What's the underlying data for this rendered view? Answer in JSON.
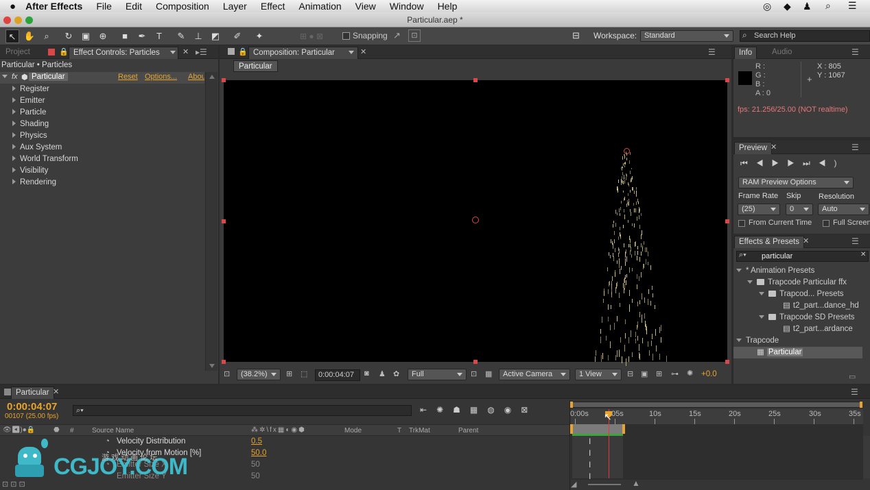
{
  "menubar": {
    "app": "After Effects",
    "items": [
      "File",
      "Edit",
      "Composition",
      "Layer",
      "Effect",
      "Animation",
      "View",
      "Window",
      "Help"
    ]
  },
  "window": {
    "title": "Particular.aep *"
  },
  "toolbar": {
    "snapping": "Snapping",
    "workspace_label": "Workspace:",
    "workspace_value": "Standard",
    "search_placeholder": "Search Help"
  },
  "left_panel": {
    "tab_project": "Project",
    "tab_effect": "Effect Controls: Particles",
    "breadcrumb": "Particular • Particles",
    "effect_name": "Particular",
    "reset": "Reset",
    "options": "Options...",
    "about": "Abou",
    "groups": [
      "Register",
      "Emitter",
      "Particle",
      "Shading",
      "Physics",
      "Aux System",
      "World Transform",
      "Visibility",
      "Rendering"
    ]
  },
  "comp_panel": {
    "tab": "Composition: Particular",
    "label": "Particular",
    "zoom": "(38.2%)",
    "timecode": "0:00:04:07",
    "resolution": "Full",
    "camera": "Active Camera",
    "views": "1 View",
    "exposure": "+0.0"
  },
  "info_panel": {
    "tab_info": "Info",
    "tab_audio": "Audio",
    "r": "R :",
    "g": "G :",
    "b": "B :",
    "a": "A : 0",
    "x": "X : 805",
    "y": "Y : 1067",
    "fps": "fps: 21.256/25.00 (NOT realtime)"
  },
  "preview_panel": {
    "tab": "Preview",
    "ram_options": "RAM Preview Options",
    "frame_rate_label": "Frame Rate",
    "frame_rate": "(25)",
    "skip_label": "Skip",
    "skip": "0",
    "resolution_label": "Resolution",
    "resolution": "Auto",
    "from_current": "From Current Time",
    "full_screen": "Full Screen"
  },
  "effects_panel": {
    "tab": "Effects & Presets",
    "search": "particular",
    "tree": [
      {
        "label": "* Animation Presets",
        "type": "group"
      },
      {
        "label": "Trapcode Particular ffx",
        "type": "folder"
      },
      {
        "label": "Trapcod... Presets",
        "type": "folder"
      },
      {
        "label": "t2_part...dance_hd",
        "type": "file"
      },
      {
        "label": "Trapcode SD Presets",
        "type": "folder"
      },
      {
        "label": "t2_part...ardance",
        "type": "file"
      },
      {
        "label": "Trapcode",
        "type": "group"
      },
      {
        "label": "Particular",
        "type": "effect"
      }
    ]
  },
  "timeline": {
    "tab": "Particular",
    "timecode": "0:00:04:07",
    "frames": "00107 (25.00 fps)",
    "columns": {
      "num": "#",
      "source": "Source Name",
      "mode": "Mode",
      "t": "T",
      "trkmat": "TrkMat",
      "parent": "Parent"
    },
    "ruler": [
      "0:00s",
      "05s",
      "10s",
      "15s",
      "20s",
      "25s",
      "30s",
      "35s"
    ],
    "rows": [
      {
        "name": "Velocity Distribution",
        "value": "0.5"
      },
      {
        "name": "Velocity from Motion [%]",
        "value": "50.0"
      },
      {
        "name": "Emitter Size X",
        "value": "50"
      },
      {
        "name": "Emitter Size Y",
        "value": "50"
      }
    ]
  },
  "watermark": {
    "text": "CGJOY.COM",
    "sub": "游 戏 动 画 论 坛"
  },
  "colors": {
    "accent": "#e8a42d",
    "handle": "#d94848",
    "particles": "#d7c785",
    "bg": "#3c3c3c"
  }
}
